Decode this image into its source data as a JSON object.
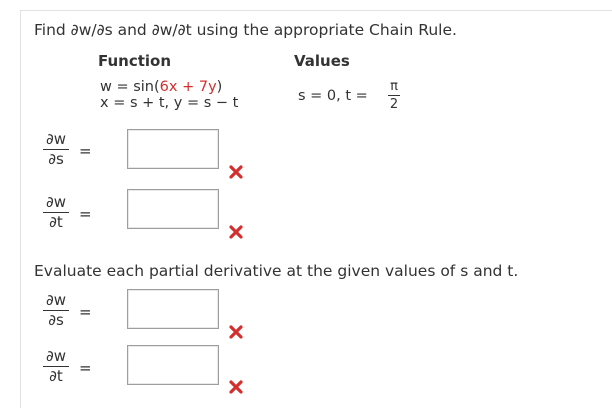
{
  "question": "Find ∂w/∂s and ∂w/∂t using the appropriate Chain Rule.",
  "headers": {
    "function": "Function",
    "values": "Values"
  },
  "function": {
    "w_prefix": "w = sin(",
    "w_arg": "6x + 7y",
    "w_suffix": ")",
    "xy": "x = s + t,  y = s − t"
  },
  "values": {
    "s_part": "s = 0,  t =",
    "t_num": "π",
    "t_den": "2"
  },
  "derivs": {
    "dw": "∂w",
    "ds": "∂s",
    "dt": "∂t",
    "eq": "="
  },
  "evaluate_text": "Evaluate each partial derivative at the given values of s and t.",
  "answers": {
    "dws": "",
    "dwt": "",
    "dws_eval": "",
    "dwt_eval": ""
  },
  "colors": {
    "incorrect": "#d32f2f",
    "text": "#333333"
  }
}
